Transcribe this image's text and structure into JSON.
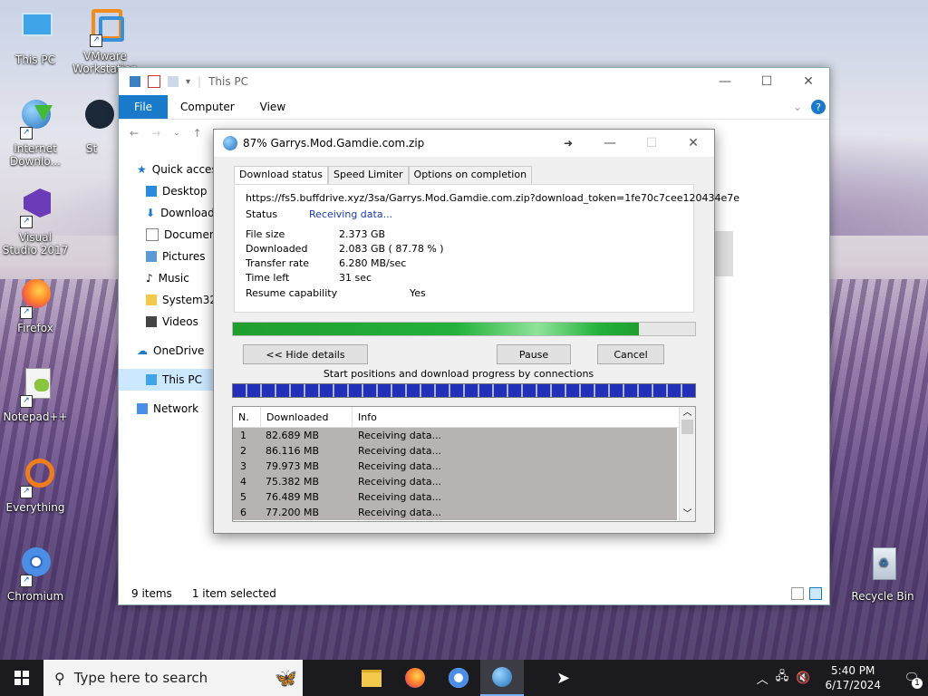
{
  "desktop": {
    "icons": [
      {
        "label": "This PC"
      },
      {
        "label": "VMware Workstation"
      },
      {
        "label": "Internet Downlo..."
      },
      {
        "label": "St"
      },
      {
        "label": "Visual Studio 2017"
      },
      {
        "label": "Firefox"
      },
      {
        "label": "Notepad++"
      },
      {
        "label": "Everything"
      },
      {
        "label": "Chromium"
      },
      {
        "label": "Recycle Bin"
      }
    ]
  },
  "explorer": {
    "title": "This PC",
    "ribbon_tabs": [
      "File",
      "Computer",
      "View"
    ],
    "sidebar": [
      {
        "label": "Quick access"
      },
      {
        "label": "Desktop"
      },
      {
        "label": "Downloads"
      },
      {
        "label": "Documents"
      },
      {
        "label": "Pictures"
      },
      {
        "label": "Music"
      },
      {
        "label": "System32"
      },
      {
        "label": "Videos"
      },
      {
        "label": "OneDrive"
      },
      {
        "label": "This PC"
      },
      {
        "label": "Network"
      }
    ],
    "status_items": "9 items",
    "status_selected": "1 item selected"
  },
  "idm": {
    "title": "87% Garrys.Mod.Gamdie.com.zip",
    "tabs": [
      "Download status",
      "Speed Limiter",
      "Options on completion"
    ],
    "url": "https://fs5.buffdrive.xyz/3sa/Garrys.Mod.Gamdie.com.zip?download_token=1fe70c7cee120434e7e",
    "status_label": "Status",
    "status_value": "Receiving data...",
    "file_size_label": "File size",
    "file_size": "2.373  GB",
    "downloaded_label": "Downloaded",
    "downloaded": "2.083  GB  ( 87.78 % )",
    "rate_label": "Transfer rate",
    "rate": "6.280  MB/sec",
    "time_label": "Time left",
    "time": "31 sec",
    "resume_label": "Resume capability",
    "resume": "Yes",
    "progress": 0.8778,
    "hide_details": "<< Hide details",
    "pause": "Pause",
    "cancel": "Cancel",
    "connections_caption": "Start positions and download progress by connections",
    "list_headers": [
      "N.",
      "Downloaded",
      "Info"
    ],
    "connections": [
      {
        "n": "1",
        "downloaded": "82.689  MB",
        "info": "Receiving data..."
      },
      {
        "n": "2",
        "downloaded": "86.116  MB",
        "info": "Receiving data..."
      },
      {
        "n": "3",
        "downloaded": "79.973  MB",
        "info": "Receiving data..."
      },
      {
        "n": "4",
        "downloaded": "75.382  MB",
        "info": "Receiving data..."
      },
      {
        "n": "5",
        "downloaded": "76.489  MB",
        "info": "Receiving data..."
      },
      {
        "n": "6",
        "downloaded": "77.200  MB",
        "info": "Receiving data..."
      }
    ]
  },
  "taskbar": {
    "search_placeholder": "Type here to search",
    "time": "5:40 PM",
    "date": "6/17/2024",
    "notification_count": "1"
  }
}
